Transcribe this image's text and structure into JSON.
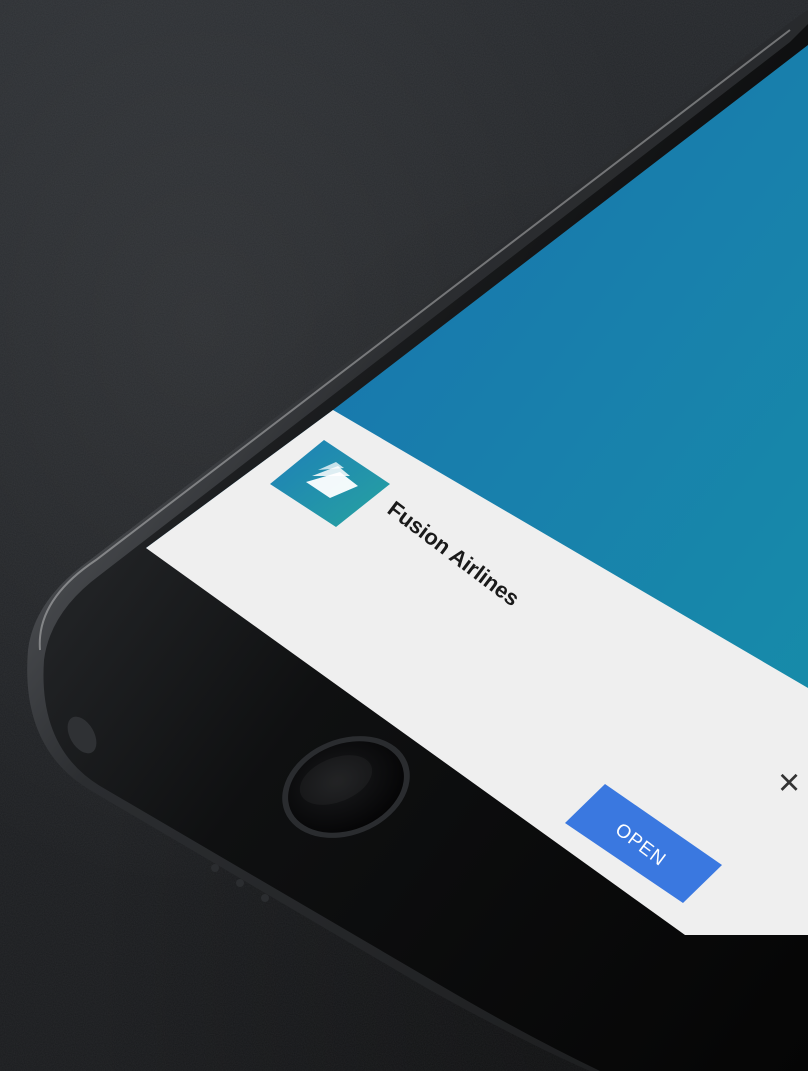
{
  "banner": {
    "app_name": "Fusion Airlines",
    "open_label": "OPEN",
    "close_symbol": "×"
  },
  "colors": {
    "screen_gradient_start": "#1a6fb0",
    "screen_gradient_end": "#168fa8",
    "banner_background": "#efefef",
    "open_button": "#3a78e0",
    "app_icon_start": "#1d7fb8",
    "app_icon_end": "#27a3a0",
    "phone_body": "#0e0f10",
    "background": "#222427"
  },
  "icons": {
    "app_icon": "fusion-airlines-logo-icon",
    "close": "close-icon",
    "home_button": "home-button-icon"
  }
}
